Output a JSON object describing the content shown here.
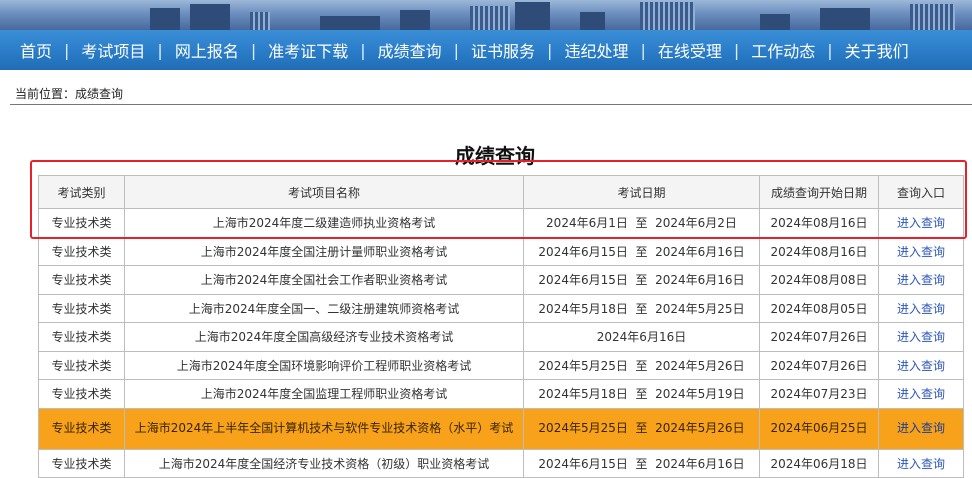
{
  "nav": {
    "items": [
      "首页",
      "考试项目",
      "网上报名",
      "准考证下载",
      "成绩查询",
      "证书服务",
      "违纪处理",
      "在线受理",
      "工作动态",
      "关于我们"
    ],
    "separator": "|"
  },
  "breadcrumb": "当前位置：成绩查询",
  "page_title": "成绩查询",
  "table": {
    "headers": [
      "考试类别",
      "考试项目名称",
      "考试日期",
      "成绩查询开始日期",
      "查询入口"
    ],
    "rows": [
      {
        "category": "专业技术类",
        "name": "上海市2024年度二级建造师执业资格考试",
        "exam_date": "2024年6月1日  至  2024年6月2日",
        "query_start": "2024年08月16日",
        "entry": "进入查询"
      },
      {
        "category": "专业技术类",
        "name": "上海市2024年度全国注册计量师职业资格考试",
        "exam_date": "2024年6月15日  至  2024年6月16日",
        "query_start": "2024年08月16日",
        "entry": "进入查询"
      },
      {
        "category": "专业技术类",
        "name": "上海市2024年度全国社会工作者职业资格考试",
        "exam_date": "2024年6月15日  至  2024年6月16日",
        "query_start": "2024年08月08日",
        "entry": "进入查询"
      },
      {
        "category": "专业技术类",
        "name": "上海市2024年度全国一、二级注册建筑师资格考试",
        "exam_date": "2024年5月18日  至  2024年5月25日",
        "query_start": "2024年08月05日",
        "entry": "进入查询"
      },
      {
        "category": "专业技术类",
        "name": "上海市2024年度全国高级经济专业技术资格考试",
        "exam_date": "2024年6月16日",
        "query_start": "2024年07月26日",
        "entry": "进入查询"
      },
      {
        "category": "专业技术类",
        "name": "上海市2024年度全国环境影响评价工程师职业资格考试",
        "exam_date": "2024年5月25日  至  2024年5月26日",
        "query_start": "2024年07月26日",
        "entry": "进入查询"
      },
      {
        "category": "专业技术类",
        "name": "上海市2024年度全国监理工程师职业资格考试",
        "exam_date": "2024年5月18日  至  2024年5月19日",
        "query_start": "2024年07月23日",
        "entry": "进入查询"
      },
      {
        "category": "专业技术类",
        "name": "上海市2024年上半年全国计算机技术与软件专业技术资格（水平）考试",
        "exam_date": "2024年5月25日  至  2024年5月26日",
        "query_start": "2024年06月25日",
        "entry": "进入查询"
      },
      {
        "category": "专业技术类",
        "name": "上海市2024年度全国经济专业技术资格（初级）职业资格考试",
        "exam_date": "2024年6月15日  至  2024年6月16日",
        "query_start": "2024年06月18日",
        "entry": "进入查询"
      }
    ]
  },
  "colors": {
    "nav_bg": "#2a7cc8",
    "highlight_row": "#f7a21a",
    "selection_box": "#e8202a",
    "link": "#2d57b8"
  }
}
